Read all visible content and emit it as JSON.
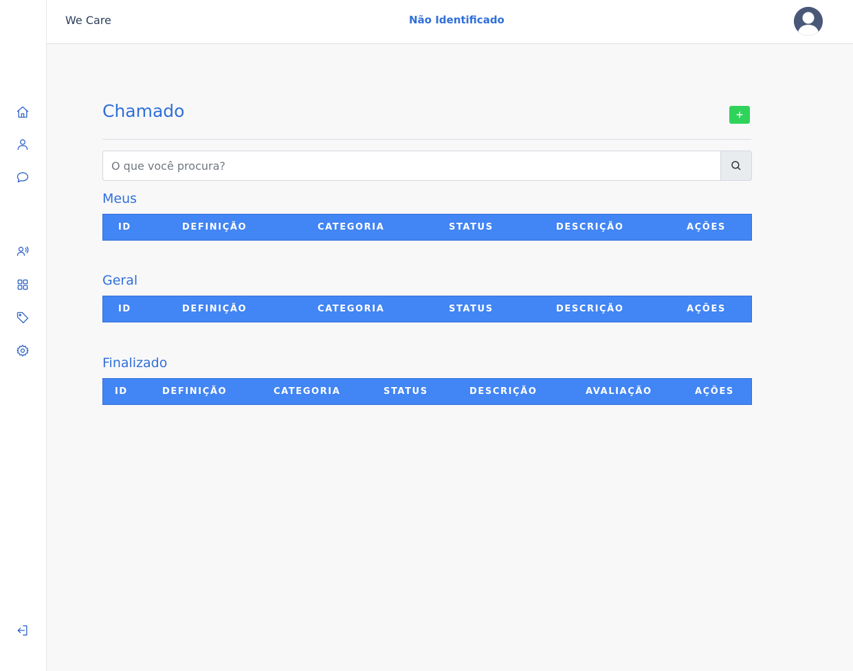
{
  "header": {
    "brand": "We Care",
    "user_status": "Não Identificado"
  },
  "sidebar": {
    "items": [
      "home-icon",
      "user-icon",
      "chat-icon",
      "contacts-icon",
      "apps-icon",
      "tag-icon",
      "settings-icon"
    ],
    "logout": "logout-icon"
  },
  "main": {
    "title": "Chamado",
    "add_label": "+",
    "search": {
      "placeholder": "O que você procura?",
      "value": ""
    },
    "sections": [
      {
        "title": "Meus",
        "columns": [
          "ID",
          "DEFINIÇÃO",
          "CATEGORIA",
          "STATUS",
          "DESCRIÇÃO",
          "AÇÕES"
        ]
      },
      {
        "title": "Geral",
        "columns": [
          "ID",
          "DEFINIÇÃO",
          "CATEGORIA",
          "STATUS",
          "DESCRIÇÃO",
          "AÇÕES"
        ]
      },
      {
        "title": "Finalizado",
        "columns": [
          "ID",
          "DEFINIÇÃO",
          "CATEGORIA",
          "STATUS",
          "DESCRIÇÃO",
          "AVALIAÇÃO",
          "AÇÕES"
        ]
      }
    ]
  },
  "colors": {
    "accent": "#2f6fd8",
    "table_header": "#4285f4",
    "add_button": "#2fd35a"
  }
}
